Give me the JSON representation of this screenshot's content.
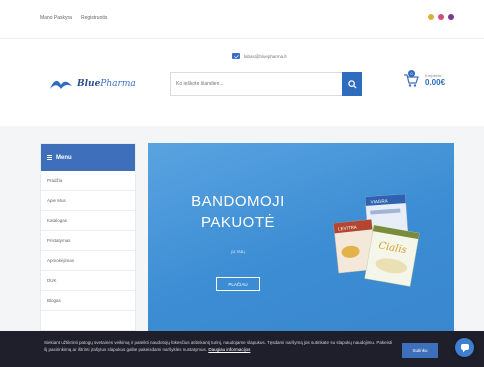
{
  "topbar": {
    "links": [
      "Mano Paskyra",
      "Registruotis"
    ],
    "flags": [
      "#d9b23a",
      "#d24d7a",
      "#7a3a8a"
    ]
  },
  "header": {
    "logo": {
      "part1": "Blue",
      "part2": "Pharma",
      "icon": "wave-logo-icon"
    },
    "email": "labas@bluepharma.lt",
    "search_placeholder": "Ko ieškote šiandien...",
    "cart": {
      "label": "Krepšelis",
      "total": "0.00€",
      "count": "0"
    }
  },
  "sidebar": {
    "title": "Menu",
    "items": [
      "Pradžia",
      "Apie Mus",
      "Katalogas",
      "Pristatymas",
      "Apmokėjimas",
      "DUK",
      "Blogas"
    ]
  },
  "banner": {
    "title_line1": "BANDOMOJI",
    "title_line2": "PAKUOTĖ",
    "subtitle": "(11 TAB.)",
    "button": "PLAČIAU",
    "products": [
      "VIAGRA",
      "LEVITRA",
      "Cialis"
    ]
  },
  "cookie": {
    "text": "Siekiant užtikrinti patogų svetainės veikimą ir pateikti naudotojų lūkesčius atitinkantį turinį, naudojame slapukus. Tęsdami naršymą jūs sutinkate su slapukų naudojimu. Pakeisti šį pasirinkimą ar ištrinti įrašytus slapukus galite pakeisdami naršyklės nustatymus.",
    "link": "Daugiau informacijos",
    "button": "Sutinku"
  },
  "colors": {
    "brand": "#2f6cbe",
    "banner": "#3c8dd4",
    "cookie_bg": "#1f1f2b"
  }
}
